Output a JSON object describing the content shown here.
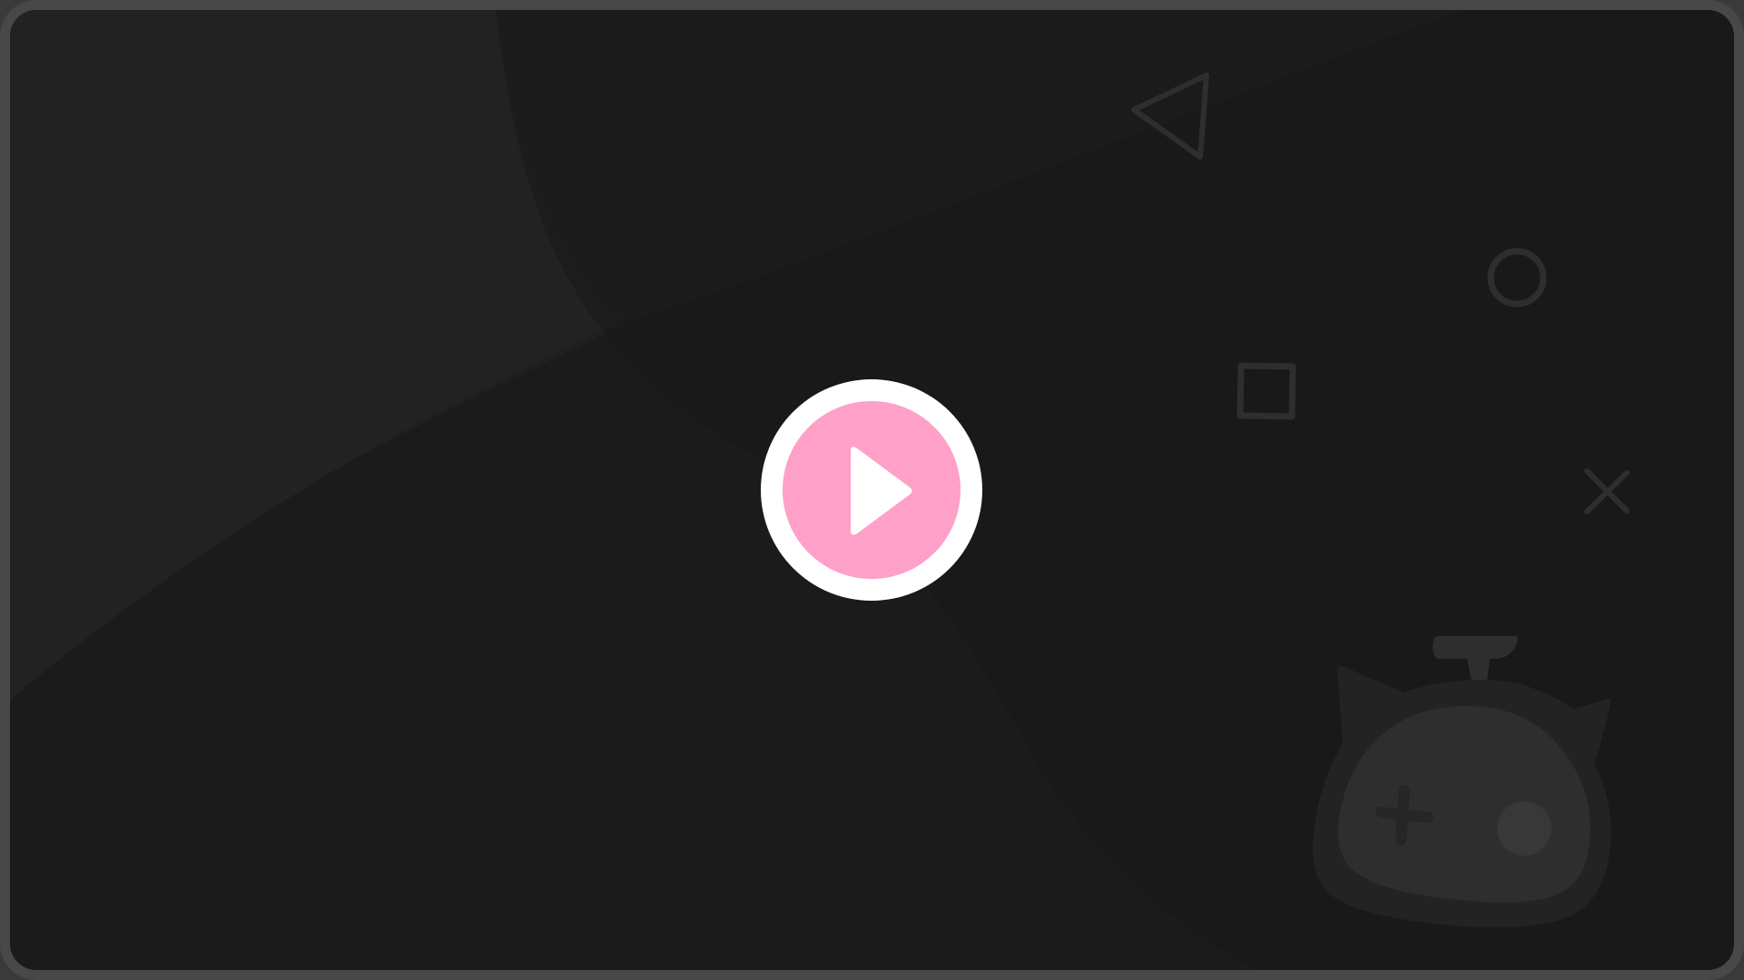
{
  "player": {
    "state": "paused",
    "play_button": {
      "icon": "play-icon",
      "ring_color": "#ffffff",
      "fill_color": "#ffa0c8"
    }
  },
  "decorations": {
    "icons": [
      "triangle-icon",
      "circle-icon",
      "square-icon",
      "cross-icon",
      "mascot-icon"
    ],
    "shape_color": "#2e2e2e",
    "background_color": "#1b1b1b",
    "frame_color": "#484848"
  }
}
